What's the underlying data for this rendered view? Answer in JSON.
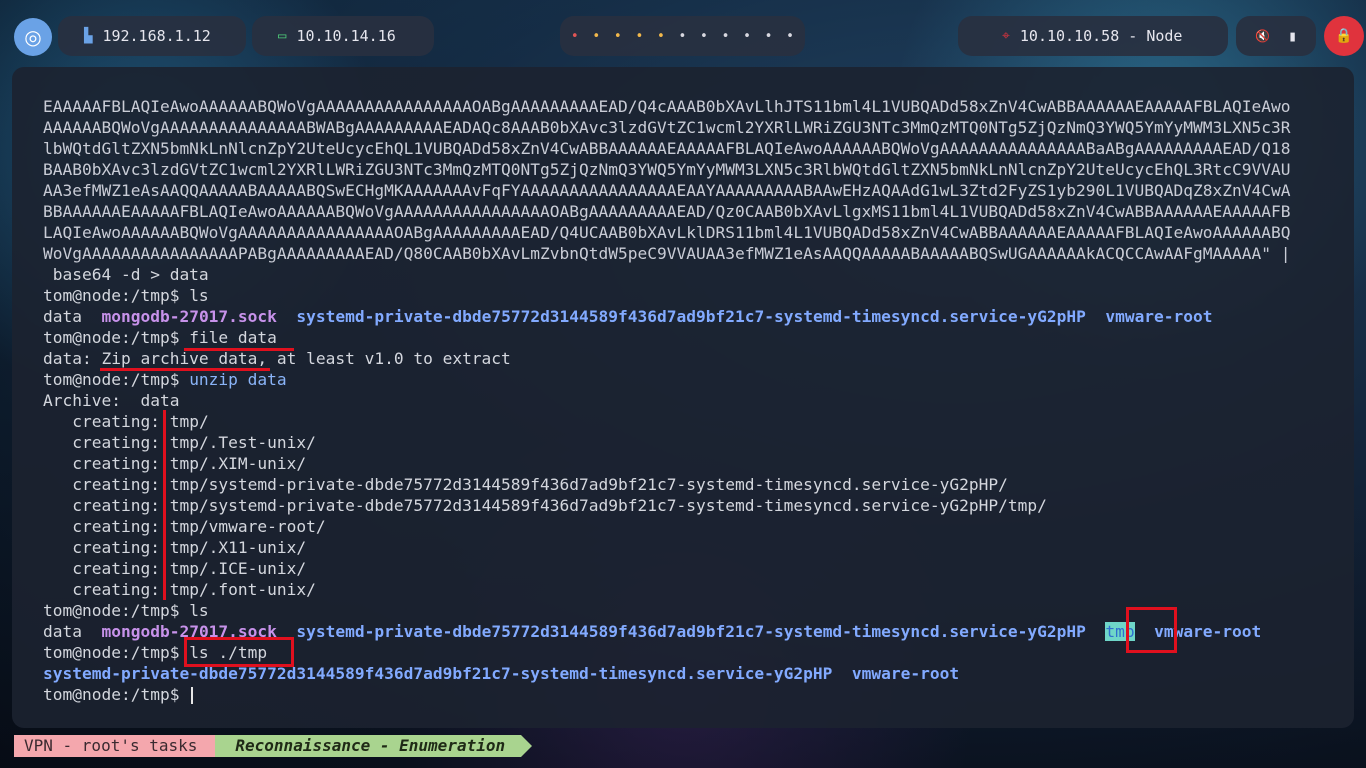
{
  "topbar": {
    "logo_glyph": "◎",
    "ip_local": "192.168.1.12",
    "ip_vpn": "10.10.14.16",
    "workspace_dots": [
      "•",
      "•",
      "•",
      "•",
      "•",
      "•",
      "•",
      "•",
      "•",
      "•",
      "•"
    ],
    "dot_colors": [
      "#e05555",
      "#f2b84b",
      "#f2b84b",
      "#f2b84b",
      "#f2b84b",
      "#d8d8e0",
      "#d8d8e0",
      "#d8d8e0",
      "#d8d8e0",
      "#d8d8e0",
      "#d8d8e0"
    ],
    "target": "10.10.10.58 - Node",
    "mute_icon": "🔇",
    "battery_icon": "▮",
    "power_icon": "🔒"
  },
  "terminal": {
    "b64_lines": [
      "EAAAAAFBLAQIeAwoAAAAAABQWoVgAAAAAAAAAAAAAAAAOABgAAAAAAAAAEAD/Q4cAAAB0bXAvLlhJTS11bml4L1VUBQADd58xZnV4CwABBAAAAAAEAAAAAFBLAQIeAwo",
      "AAAAAABQWoVgAAAAAAAAAAAAAAABWABgAAAAAAAAAEADAQc8AAAB0bXAvc3lzdGVtZC1wcml2YXRlLWRiZGU3NTc3MmQzMTQ0NTg5ZjQzNmQ3YWQ5YmYyMWM3LXN5c3R",
      "lbWQtdGltZXN5bmNkLnNlcnZpY2UteUcycEhQL1VUBQADd58xZnV4CwABBAAAAAAEAAAAAFBLAQIeAwoAAAAAABQWoVgAAAAAAAAAAAAAAABaABgAAAAAAAAAEAD/Q18",
      "BAAB0bXAvc3lzdGVtZC1wcml2YXRlLWRiZGU3NTc3MmQzMTQ0NTg5ZjQzNmQ3YWQ5YmYyMWM3LXN5c3RlbWQtdGltZXN5bmNkLnNlcnZpY2UteUcycEhQL3RtcC9VVAU",
      "AA3efMWZ1eAsAAQQAAAAABAAAAABQSwECHgMKAAAAAAAvFqFYAAAAAAAAAAAAAAAAEAAYAAAAAAAAABAAwEHzAQAAdG1wL3Ztd2FyZS1yb290L1VUBQADqZ8xZnV4CwA",
      "BBAAAAAAEAAAAAFBLAQIeAwoAAAAAABQWoVgAAAAAAAAAAAAAAAAOABgAAAAAAAAAEAD/Qz0CAAB0bXAvLlgxMS11bml4L1VUBQADd58xZnV4CwABBAAAAAAEAAAAAFB",
      "LAQIeAwoAAAAAABQWoVgAAAAAAAAAAAAAAAAOABgAAAAAAAAAEAD/Q4UCAAB0bXAvLklDRS11bml4L1VUBQADd58xZnV4CwABBAAAAAAEAAAAAFBLAQIeAwoAAAAAABQ",
      "WoVgAAAAAAAAAAAAAAAAPABgAAAAAAAAAEAD/Q80CAAB0bXAvLmZvbnQtdW5peC9VVAUAA3efMWZ1eAsAAQQAAAAABAAAAABQSwUGAAAAAAkACQCCAwAAFgMAAAAA\" |"
    ],
    "pipe_cmd": " base64 -d > data",
    "prompt": "tom@node:/tmp$ ",
    "cmd_ls": "ls",
    "ls1": {
      "data": "data",
      "sock": "mongodb-27017.sock",
      "sysd": "systemd-private-dbde75772d3144589f436d7ad9bf21c7-systemd-timesyncd.service-yG2pHP",
      "vmw": "vmware-root"
    },
    "cmd_file": "file data",
    "file_out": "data: Zip archive data, at least v1.0 to extract",
    "cmd_unzip": "unzip data",
    "archive_line": "Archive:  data",
    "creating_label": "   creating: ",
    "creating_items": [
      "tmp/",
      "tmp/.Test-unix/",
      "tmp/.XIM-unix/",
      "tmp/systemd-private-dbde75772d3144589f436d7ad9bf21c7-systemd-timesyncd.service-yG2pHP/",
      "tmp/systemd-private-dbde75772d3144589f436d7ad9bf21c7-systemd-timesyncd.service-yG2pHP/tmp/",
      "tmp/vmware-root/",
      "tmp/.X11-unix/",
      "tmp/.ICE-unix/",
      "tmp/.font-unix/"
    ],
    "ls2_tmp": "tmp",
    "cmd_ls_tmp": "ls ./tmp",
    "ls3": {
      "sysd": "systemd-private-dbde75772d3144589f436d7ad9bf21c7-systemd-timesyncd.service-yG2pHP",
      "vmw": "vmware-root"
    }
  },
  "statusbar": {
    "seg1": "VPN - root's tasks",
    "seg2": "Reconnaissance - Enumeration"
  }
}
